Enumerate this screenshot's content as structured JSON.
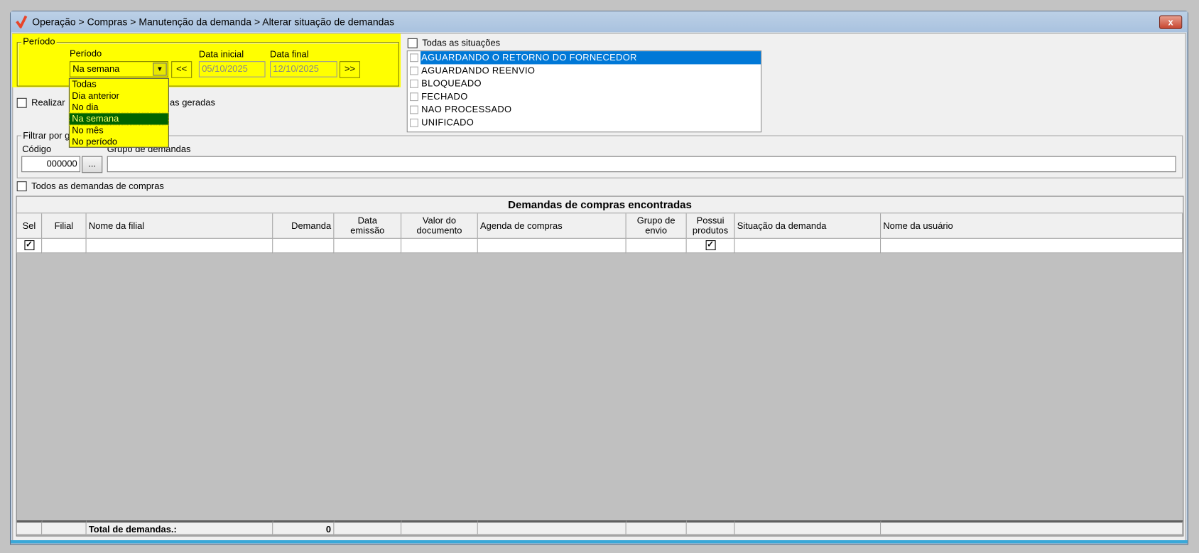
{
  "window": {
    "title": "Operação > Compras > Manutenção da demanda > Alterar situação de demandas",
    "close_label": "x"
  },
  "periodo": {
    "group_label": "Período",
    "combo_label": "Período",
    "combo_value": "Na semana",
    "prev_label": "<<",
    "next_label": ">>",
    "data_inicial_label": "Data inicial",
    "data_inicial": "05/10/2025",
    "data_final_label": "Data final",
    "data_final": "12/10/2025",
    "options": [
      "Todas",
      "Dia anterior",
      "No dia",
      "Na semana",
      "No mês",
      "No período"
    ],
    "selected_option": "Na semana",
    "highlight_color": "#ffff00"
  },
  "realizar": {
    "label_start": "Realizar",
    "label_end": "as geradas",
    "checked": false
  },
  "situacoes": {
    "all_label": "Todas as situações",
    "items": [
      "AGUARDANDO O RETORNO DO FORNECEDOR",
      "AGUARDANDO REENVIO",
      "BLOQUEADO",
      "FECHADO",
      "NAO PROCESSADO",
      "UNIFICADO"
    ],
    "selected": "AGUARDANDO O RETORNO DO FORNECEDOR"
  },
  "filtro": {
    "group_label": "Filtrar por g",
    "codigo_label": "Código",
    "codigo_value": "000000",
    "browse_label": "...",
    "grupo_label": "Grupo de demandas",
    "grupo_value": ""
  },
  "todos_demandas": {
    "label": "Todos as demandas de compras",
    "checked": false
  },
  "grid": {
    "title": "Demandas de compras encontradas",
    "columns": [
      "Sel",
      "Filial",
      "Nome da filial",
      "Demanda",
      "Data emissão",
      "Valor do documento",
      "Agenda de compras",
      "Grupo de envio",
      "Possui produtos",
      "Situação da demanda",
      "Nome da usuário"
    ],
    "total_label": "Total de demandas.:",
    "total_value": "0"
  }
}
